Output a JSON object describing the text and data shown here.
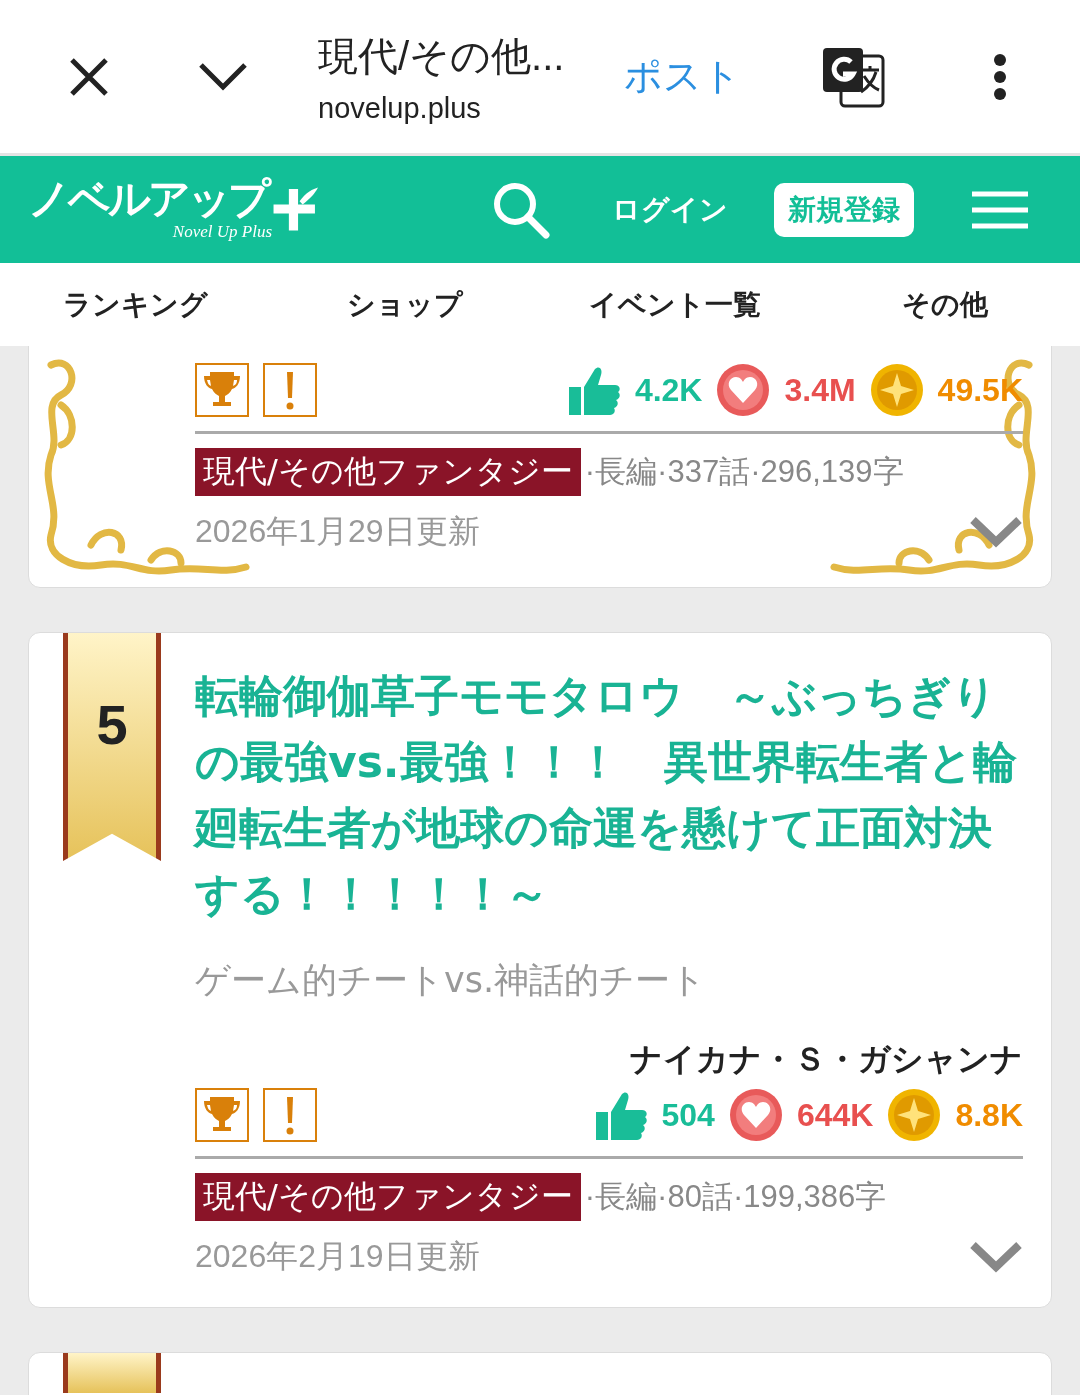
{
  "browser_bar": {
    "title": "現代/その他...",
    "url": "novelup.plus",
    "post": "ポスト"
  },
  "site_header": {
    "logo": "ノベルアップ",
    "logo_sub": "Novel Up Plus",
    "login": "ログイン",
    "signup": "新規登録"
  },
  "nav": [
    {
      "label": "ランキング"
    },
    {
      "label": "ショップ"
    },
    {
      "label": "イベント一覧"
    },
    {
      "label": "その他"
    }
  ],
  "works": [
    {
      "kind": "ornate",
      "badges": [
        {
          "kind": "trophy"
        },
        {
          "kind": "notice"
        }
      ],
      "stats": [
        {
          "kind": "like",
          "value": "4.2K"
        },
        {
          "kind": "heart",
          "value": "3.4M"
        },
        {
          "kind": "star",
          "value": "49.5K"
        }
      ],
      "genre": "現代/その他ファンタジー",
      "meta": "·長編·337話·296,139字",
      "updated": "2026年1月29日更新"
    },
    {
      "kind": "ranked",
      "rank": "5",
      "title": "転輪御伽草子モモタロウ　～ぶっちぎりの最強vs.最強！！！　異世界転生者と輪廻転生者が地球の命運を懸けて正面対決する！！！！！～",
      "catch": "ゲーム的チートvs.神話的チート",
      "author": "ナイカナ・Ｓ・ガシャンナ",
      "badges": [
        {
          "kind": "trophy"
        },
        {
          "kind": "notice"
        }
      ],
      "stats": [
        {
          "kind": "like",
          "value": "504"
        },
        {
          "kind": "heart",
          "value": "644K"
        },
        {
          "kind": "star",
          "value": "8.8K"
        }
      ],
      "genre": "現代/その他ファンタジー",
      "meta": "·長編·80話·199,386字",
      "updated": "2026年2月19日更新"
    },
    {
      "kind": "cut"
    }
  ]
}
